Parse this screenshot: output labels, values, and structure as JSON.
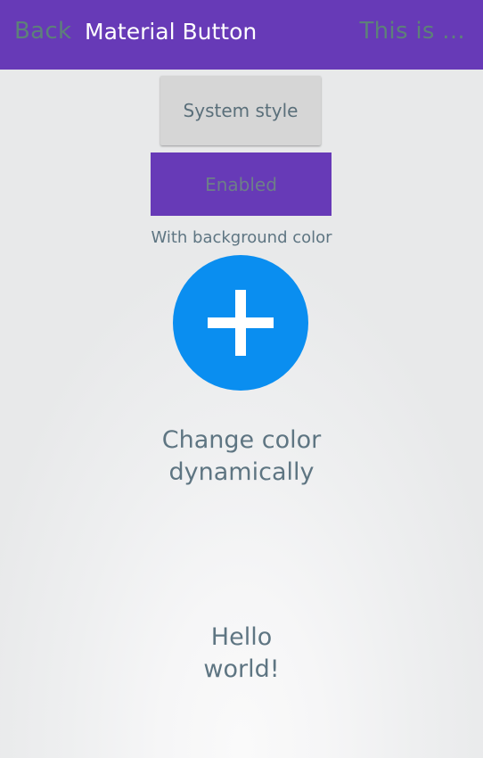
{
  "appbar": {
    "back_label": "Back",
    "title": "Material Button",
    "right_label": "This is ...",
    "color": "#673ab7"
  },
  "buttons": {
    "system_style_label": "System style",
    "enabled_label": "Enabled",
    "enabled_color": "#673ab7"
  },
  "labels": {
    "with_background_color": "With background color",
    "change_color_line1": "Change color",
    "change_color_line2": "dynamically",
    "hello_line1": "Hello",
    "hello_line2": "world!"
  },
  "fab": {
    "icon": "plus-icon",
    "color": "#0a8ef0"
  }
}
